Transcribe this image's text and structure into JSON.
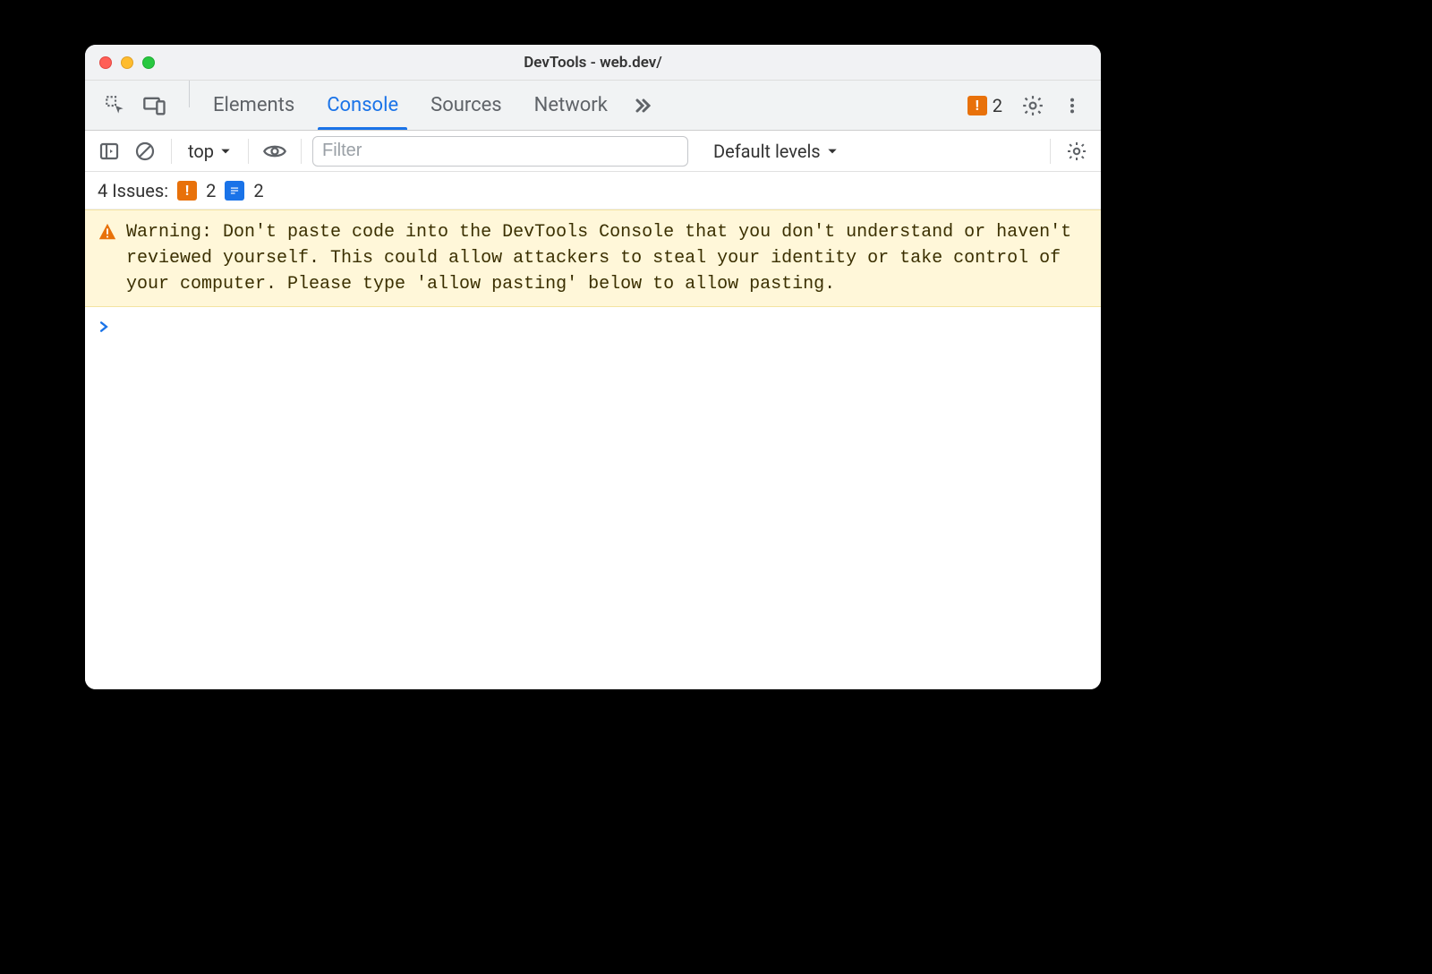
{
  "window": {
    "title": "DevTools - web.dev/"
  },
  "tabs": {
    "elements": "Elements",
    "console": "Console",
    "sources": "Sources",
    "network": "Network"
  },
  "header_issue_count": "2",
  "toolbar": {
    "context": "top",
    "filter_placeholder": "Filter",
    "levels": "Default levels"
  },
  "issues": {
    "label": "4 Issues:",
    "orange_count": "2",
    "blue_count": "2"
  },
  "console": {
    "warning": "Warning: Don't paste code into the DevTools Console that you don't understand or haven't reviewed yourself. This could allow attackers to steal your identity or take control of your computer. Please type 'allow pasting' below to allow pasting."
  }
}
